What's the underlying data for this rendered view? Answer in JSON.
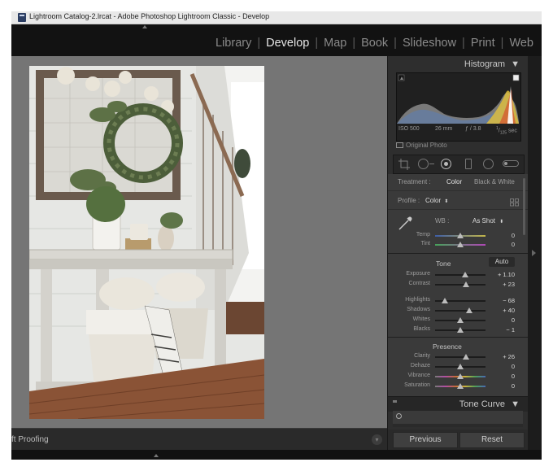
{
  "window": {
    "title": "Lightroom Catalog-2.lrcat - Adobe Photoshop Lightroom Classic - Develop"
  },
  "modules": [
    {
      "label": "Library",
      "active": false
    },
    {
      "label": "Develop",
      "active": true
    },
    {
      "label": "Map",
      "active": false
    },
    {
      "label": "Book",
      "active": false
    },
    {
      "label": "Slideshow",
      "active": false
    },
    {
      "label": "Print",
      "active": false
    },
    {
      "label": "Web",
      "active": false
    }
  ],
  "histogram": {
    "title": "Histogram",
    "iso": "ISO 500",
    "focal": "26 mm",
    "aperture": "ƒ / 3.8",
    "shutter_num": "1",
    "shutter_den": "125",
    "shutter_unit": "sec",
    "original_photo": "Original Photo"
  },
  "basic": {
    "treatment_label": "Treatment :",
    "treatment_color": "Color",
    "treatment_bw": "Black & White",
    "profile_label": "Profile :",
    "profile_value": "Color",
    "wb_label": "WB :",
    "wb_value": "As Shot",
    "temp_label": "Temp",
    "temp_value": "0",
    "tint_label": "Tint",
    "tint_value": "0",
    "tone_title": "Tone",
    "auto_label": "Auto",
    "exposure_label": "Exposure",
    "exposure_value": "+ 1.10",
    "contrast_label": "Contrast",
    "contrast_value": "+ 23",
    "highlights_label": "Highlights",
    "highlights_value": "− 68",
    "shadows_label": "Shadows",
    "shadows_value": "+ 40",
    "whites_label": "Whites",
    "whites_value": "0",
    "blacks_label": "Blacks",
    "blacks_value": "− 1",
    "presence_title": "Presence",
    "clarity_label": "Clarity",
    "clarity_value": "+ 26",
    "dehaze_label": "Dehaze",
    "dehaze_value": "0",
    "vibrance_label": "Vibrance",
    "vibrance_value": "0",
    "saturation_label": "Saturation",
    "saturation_value": "0"
  },
  "tone_curve": {
    "title": "Tone Curve"
  },
  "buttons": {
    "previous": "Previous",
    "reset": "Reset"
  },
  "toolbar": {
    "soft_proofing": "ft Proofing"
  },
  "colors": {
    "panel_bg": "#2e2e2e",
    "work_bg": "#757575",
    "module_bar_bg": "#121212",
    "active_module": "#e6e6e6"
  }
}
